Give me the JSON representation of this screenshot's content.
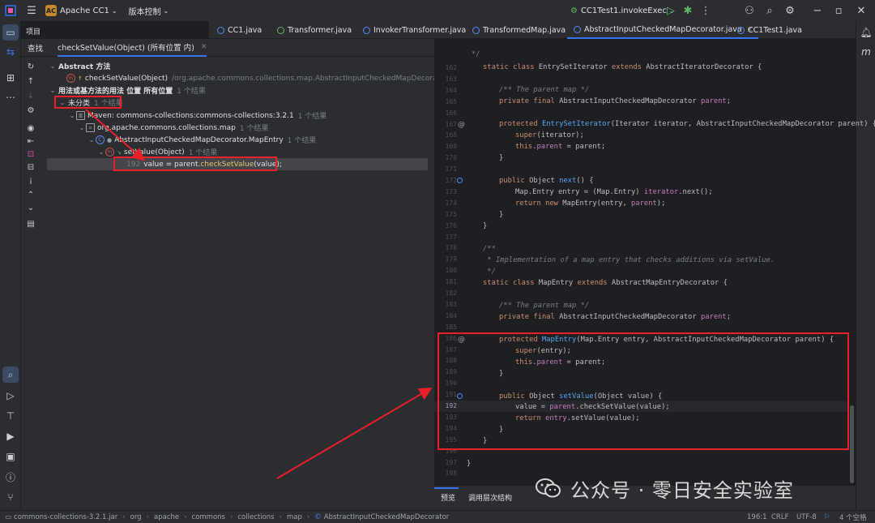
{
  "titlebar": {
    "project_badge": "AC",
    "project_name": "Apache CC1",
    "vcs_label": "版本控制",
    "run_config": "CC1Test1.invokeExec"
  },
  "left_strip": {
    "project_label": "项目"
  },
  "find_panel": {
    "tab_title": "查找",
    "query_tab": "checkSetValue(Object) (所有位置 内)",
    "tree": [
      {
        "text": "Abstract 方法",
        "count": ""
      },
      {
        "text": "checkSetValue(Object)",
        "path": "/org.apache.commons.collections.map.AbstractInputCheckedMapDecorator"
      },
      {
        "text": "用法或基方法的用法 位置 所有位置",
        "count": "1 个结果"
      },
      {
        "text": "未分类",
        "count": "1 个结果"
      },
      {
        "text": "Maven: commons-collections:commons-collections:3.2.1",
        "count": "1 个结果"
      },
      {
        "text": "org.apache.commons.collections.map",
        "count": "1 个结果"
      },
      {
        "text": "AbstractInputCheckedMapDecorator.MapEntry",
        "count": "1 个结果"
      },
      {
        "text": "setValue(Object)",
        "count": "1 个结果"
      },
      {
        "line": "192",
        "code_pre": "value = parent.",
        "code_hl": "checkSetValue",
        "code_post": "(value);"
      }
    ]
  },
  "tabs": [
    {
      "label": "CC1.java"
    },
    {
      "label": "Transformer.java"
    },
    {
      "label": "InvokerTransformer.java"
    },
    {
      "label": "TransformedMap.java"
    },
    {
      "label": "AbstractInputCheckedMapDecorator.java"
    },
    {
      "label": "CC1Test1.java"
    }
  ],
  "editor": {
    "line_numbers": [
      "162",
      "163",
      "164",
      "165",
      "166",
      "167",
      "168",
      "169",
      "170",
      "171",
      "172",
      "173",
      "174",
      "175",
      "176",
      "177",
      "178",
      "179",
      "180",
      "181",
      "182",
      "183",
      "184",
      "185",
      "186",
      "187",
      "188",
      "189",
      "190",
      "191",
      "192",
      "193",
      "194",
      "195",
      "196",
      "197",
      "198"
    ],
    "current_line": "192",
    "bottom_tabs": [
      "预览",
      "调用层次结构"
    ]
  },
  "statusbar": {
    "breadcrumb": [
      "commons-collections-3.2.1.jar",
      "org",
      "apache",
      "commons",
      "collections",
      "map",
      "AbstractInputCheckedMapDecorator"
    ],
    "position": "196:1",
    "line_sep": "CRLF",
    "encoding": "UTF-8",
    "indent": "4 个空格"
  },
  "watermark": {
    "text": "公众号 · 零日安全实验室"
  },
  "colors": {
    "accent": "#3574f0",
    "annotation_red": "#e8202a",
    "keyword": "#cf8e6d",
    "function": "#56a8f5",
    "field": "#c77dbb"
  }
}
